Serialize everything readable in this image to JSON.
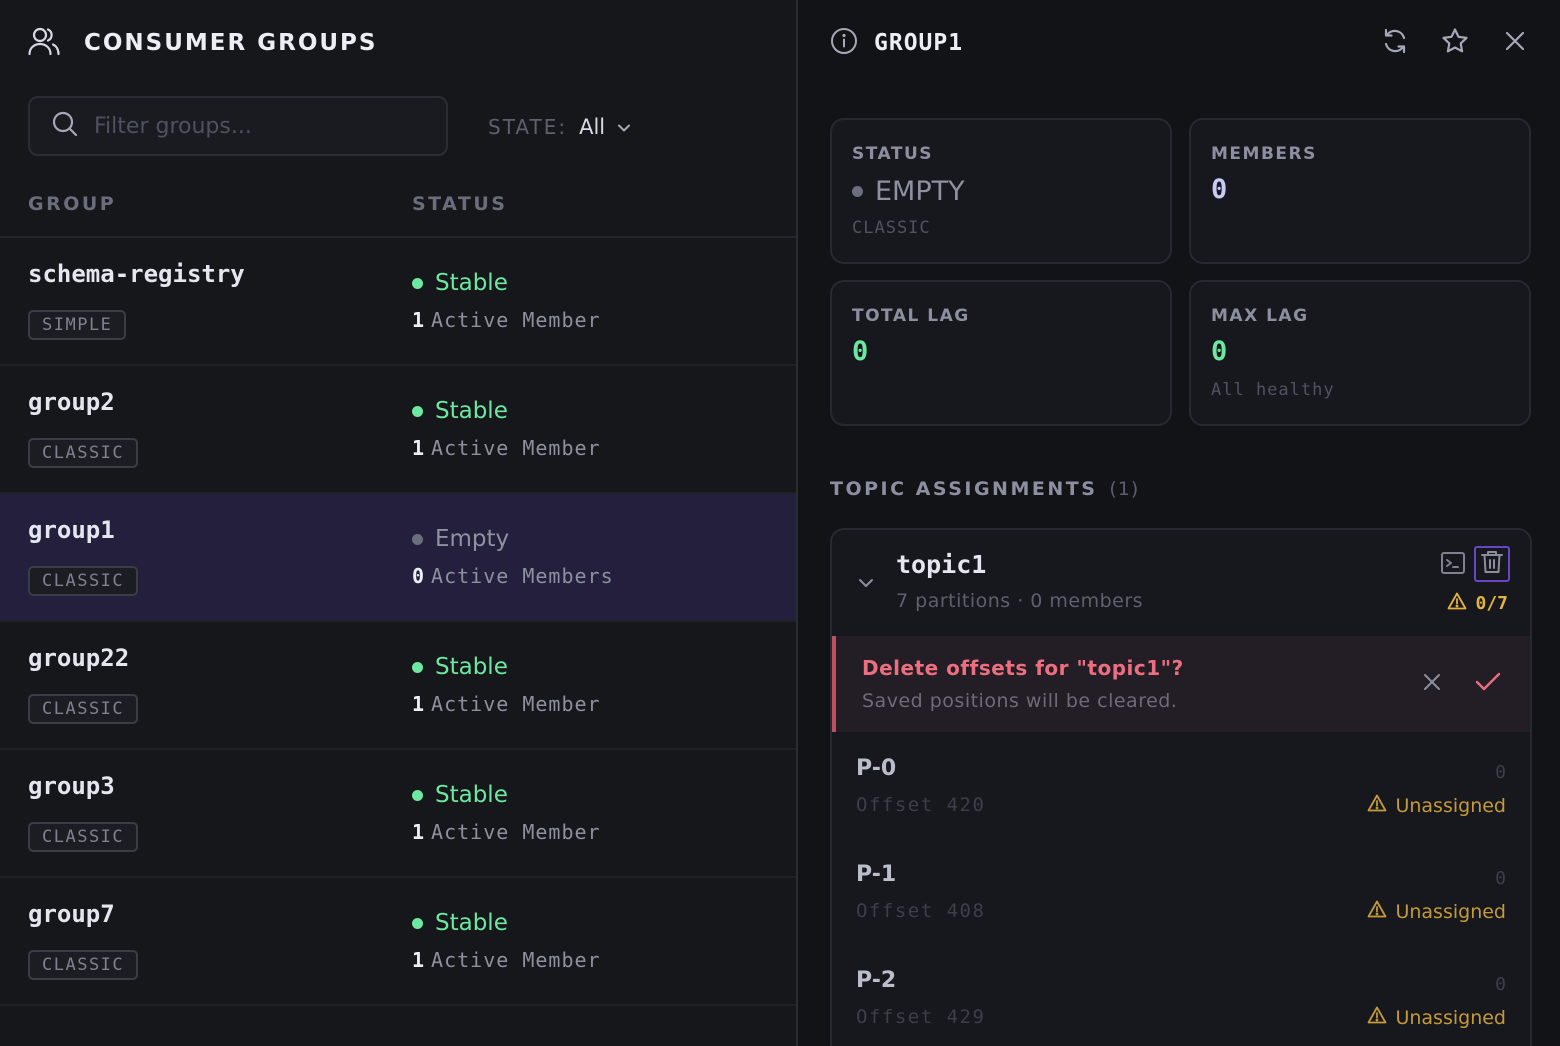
{
  "colors": {
    "stable": "#6ee7a0",
    "empty": "#6b6e7c",
    "accent": "#7c5cff",
    "warning": "#e3b341",
    "danger": "#ec6f80"
  },
  "left": {
    "title": "CONSUMER GROUPS",
    "search": {
      "placeholder": "Filter groups...",
      "value": ""
    },
    "state_filter": {
      "label": "STATE:",
      "value": "All"
    },
    "columns": {
      "group": "GROUP",
      "status": "STATUS"
    },
    "groups": [
      {
        "name": "schema-registry",
        "type": "SIMPLE",
        "status": "Stable",
        "count": "1",
        "members_label": "Active Member",
        "selected": false
      },
      {
        "name": "group2",
        "type": "CLASSIC",
        "status": "Stable",
        "count": "1",
        "members_label": "Active Member",
        "selected": false
      },
      {
        "name": "group1",
        "type": "CLASSIC",
        "status": "Empty",
        "count": "0",
        "members_label": "Active Members",
        "selected": true
      },
      {
        "name": "group22",
        "type": "CLASSIC",
        "status": "Stable",
        "count": "1",
        "members_label": "Active Member",
        "selected": false
      },
      {
        "name": "group3",
        "type": "CLASSIC",
        "status": "Stable",
        "count": "1",
        "members_label": "Active Member",
        "selected": false
      },
      {
        "name": "group7",
        "type": "CLASSIC",
        "status": "Stable",
        "count": "1",
        "members_label": "Active Member",
        "selected": false
      }
    ]
  },
  "detail": {
    "title": "GROUP1",
    "cards": {
      "status": {
        "label": "STATUS",
        "value": "EMPTY",
        "sub": "CLASSIC"
      },
      "members": {
        "label": "MEMBERS",
        "value": "0"
      },
      "total_lag": {
        "label": "TOTAL LAG",
        "value": "0"
      },
      "max_lag": {
        "label": "MAX LAG",
        "value": "0",
        "sub": "All healthy"
      }
    },
    "topic_assignments": {
      "title": "TOPIC ASSIGNMENTS",
      "count": "(1)"
    },
    "topic": {
      "name": "topic1",
      "meta": "7 partitions · 0 members",
      "ratio": "0/7",
      "confirm": {
        "title": "Delete offsets for \"topic1\"?",
        "desc": "Saved positions will be cleared."
      },
      "partitions": [
        {
          "name": "P-0",
          "offset": "Offset 420",
          "lag": "0",
          "state": "Unassigned"
        },
        {
          "name": "P-1",
          "offset": "Offset 408",
          "lag": "0",
          "state": "Unassigned"
        },
        {
          "name": "P-2",
          "offset": "Offset 429",
          "lag": "0",
          "state": "Unassigned"
        }
      ]
    }
  }
}
